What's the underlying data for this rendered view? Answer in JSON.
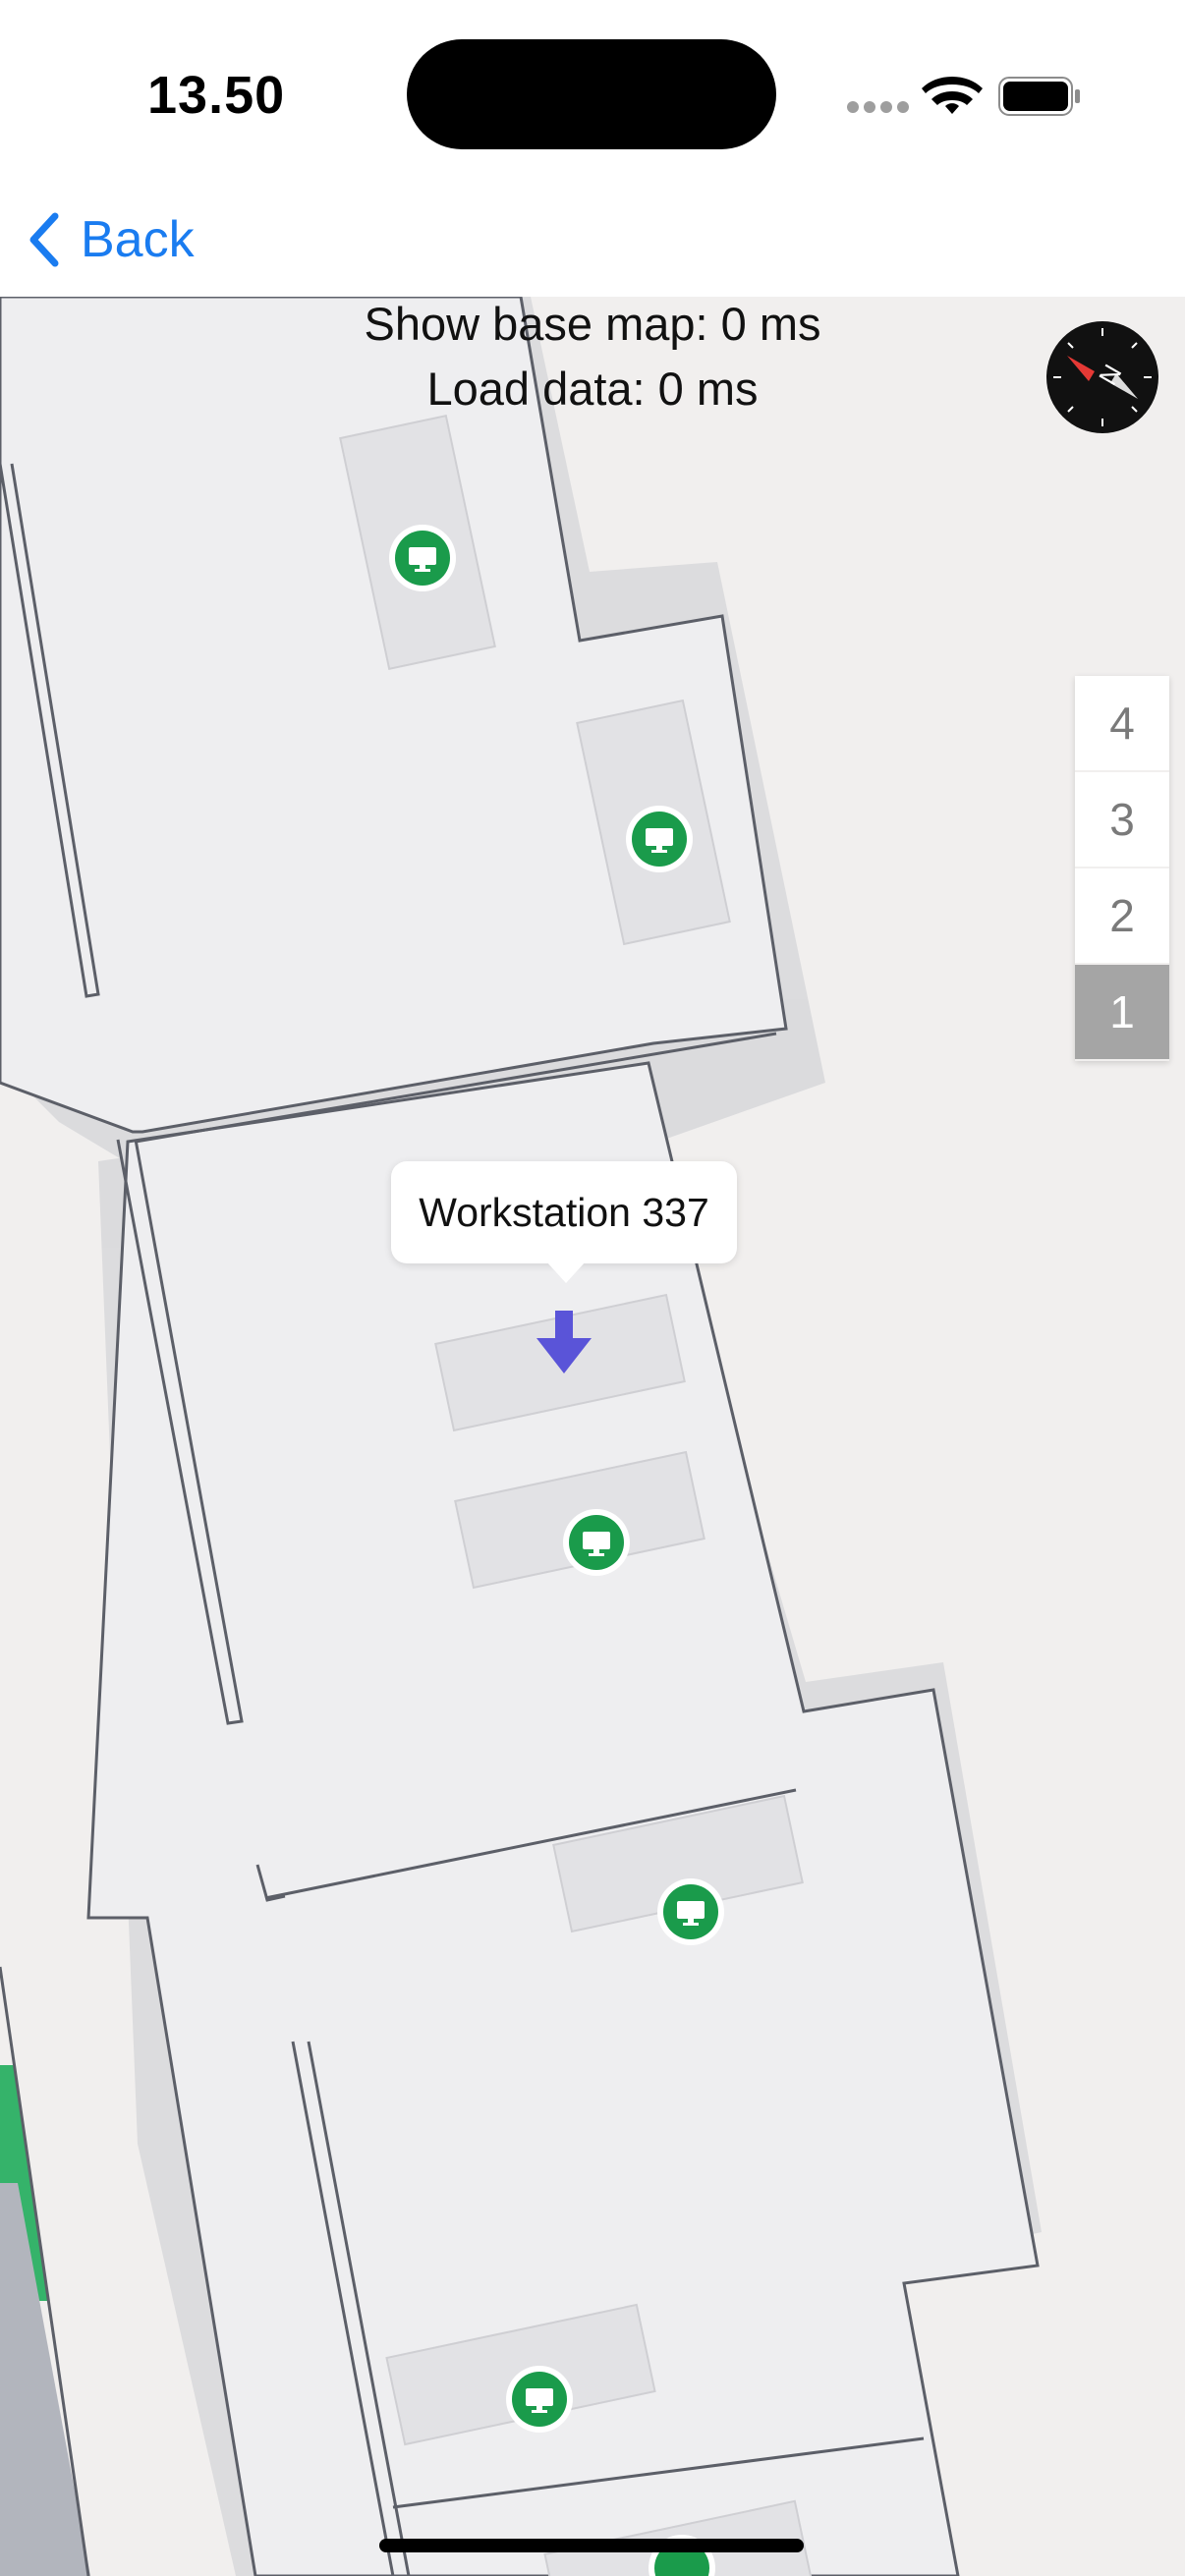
{
  "status_bar": {
    "time": "13.50"
  },
  "nav": {
    "back_label": "Back"
  },
  "perf": {
    "base_map": "Show base map: 0 ms",
    "load_data": "Load data: 0 ms"
  },
  "floors": [
    "4",
    "3",
    "2",
    "1"
  ],
  "selected_floor": "1",
  "callout": {
    "text": "Workstation 337"
  },
  "icons": {
    "back": "chevron-left-icon",
    "compass": "compass-icon",
    "workstation": "monitor-icon",
    "selected_marker": "down-arrow-icon"
  },
  "colors": {
    "accent": "#1a7cf0",
    "workstation_pin": "#1a9b4b",
    "selected_marker": "#5a54d8",
    "floor_fill": "#eeeef0",
    "background": "#f1efee"
  }
}
